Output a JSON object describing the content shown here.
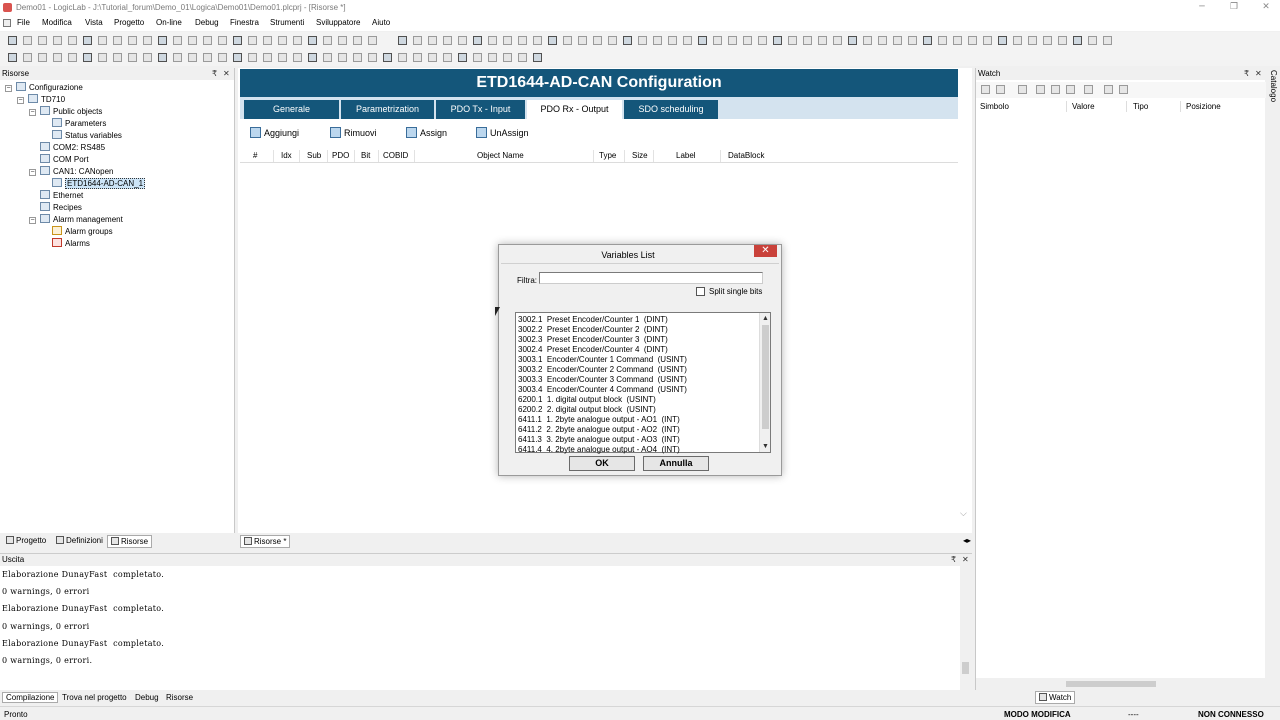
{
  "window": {
    "title": "Demo01 - LogicLab - J:\\Tutorial_forum\\Demo_01\\Logica\\Demo01\\Demo01.plcprj - [Risorse *]",
    "minimize_icon": "minimize-icon",
    "restore_icon": "restore-icon",
    "close_icon": "close-icon"
  },
  "menu": [
    "File",
    "Modifica",
    "Vista",
    "Progetto",
    "On-line",
    "Debug",
    "Finestra",
    "Strumenti",
    "Sviluppatore",
    "Aiuto"
  ],
  "left_panel": {
    "title": "Risorse",
    "tree": [
      {
        "label": "Configurazione",
        "icon": "config-icon"
      },
      {
        "label": "TD710",
        "icon": "device-icon"
      },
      {
        "label": "Public objects",
        "icon": "objects-icon"
      },
      {
        "label": "Parameters",
        "icon": "table-icon"
      },
      {
        "label": "Status variables",
        "icon": "table-icon"
      },
      {
        "label": "COM2: RS485",
        "icon": "serial-port-icon"
      },
      {
        "label": "COM Port",
        "icon": "serial-port-icon"
      },
      {
        "label": "CAN1: CANopen",
        "icon": "canbus-icon"
      },
      {
        "label": "ETD1644-AD-CAN_1",
        "icon": "module-icon"
      },
      {
        "label": "Ethernet",
        "icon": "ethernet-icon"
      },
      {
        "label": "Recipes",
        "icon": "recipes-icon"
      },
      {
        "label": "Alarm management",
        "icon": "alarm-management-icon"
      },
      {
        "label": "Alarm groups",
        "icon": "alarm-groups-icon"
      },
      {
        "label": "Alarms",
        "icon": "warning-icon"
      }
    ],
    "tabs": [
      "Progetto",
      "Definizioni",
      "Risorse"
    ]
  },
  "document": {
    "title": "ETD1644-AD-CAN Configuration",
    "tabs": [
      "Generale",
      "Parametrization",
      "PDO Tx - Input",
      "PDO Rx - Output",
      "SDO scheduling"
    ],
    "active_tab": "PDO Rx - Output",
    "actions": [
      "Aggiungi",
      "Rimuovi",
      "Assign",
      "UnAssign"
    ],
    "columns": [
      "#",
      "Idx",
      "Sub",
      "PDO",
      "Bit",
      "COBID",
      "Object Name",
      "Type",
      "Size",
      "Label",
      "DataBlock"
    ],
    "tab_label": "Risorse *"
  },
  "dialog": {
    "title": "Variables List",
    "filter_label": "Filtra:",
    "filter_value": "",
    "split_label": "Split single bits",
    "split_checked": false,
    "items": [
      "3002.1  Preset Encoder/Counter 1  (DINT)",
      "3002.2  Preset Encoder/Counter 2  (DINT)",
      "3002.3  Preset Encoder/Counter 3  (DINT)",
      "3002.4  Preset Encoder/Counter 4  (DINT)",
      "3003.1  Encoder/Counter 1 Command  (USINT)",
      "3003.2  Encoder/Counter 2 Command  (USINT)",
      "3003.3  Encoder/Counter 3 Command  (USINT)",
      "3003.4  Encoder/Counter 4 Command  (USINT)",
      "6200.1  1. digital output block  (USINT)",
      "6200.2  2. digital output block  (USINT)",
      "6411.1  1. 2byte analogue output - AO1  (INT)",
      "6411.2  2. 2byte analogue output - AO2  (INT)",
      "6411.3  3. 2byte analogue output - AO3  (INT)",
      "6411.4  4. 2byte analogue output - AO4  (INT)"
    ],
    "ok_label": "OK",
    "cancel_label": "Annulla"
  },
  "watch": {
    "title": "Watch",
    "columns": [
      "Simbolo",
      "Valore",
      "Tipo",
      "Posizione"
    ],
    "tab_label": "Watch",
    "side_tab": "Catalogo"
  },
  "output": {
    "title": "Uscita",
    "lines": [
      "Elaborazione DunayFast  completato.",
      "0 warnings, 0 errori",
      "Elaborazione DunayFast  completato.",
      "0 warnings, 0 errori",
      "Elaborazione DunayFast  completato.",
      "0 warnings, 0 errori."
    ],
    "tabs": [
      "Compilazione",
      "Trova nel progetto",
      "Debug",
      "Risorse"
    ]
  },
  "status": {
    "left": "Pronto",
    "mode": "MODO MODIFICA",
    "dashes": "----",
    "connection": "NON CONNESSO"
  },
  "colors": {
    "header_blue": "#14567a",
    "tab_strip": "#d4e3ef",
    "close_red": "#c9413a"
  }
}
